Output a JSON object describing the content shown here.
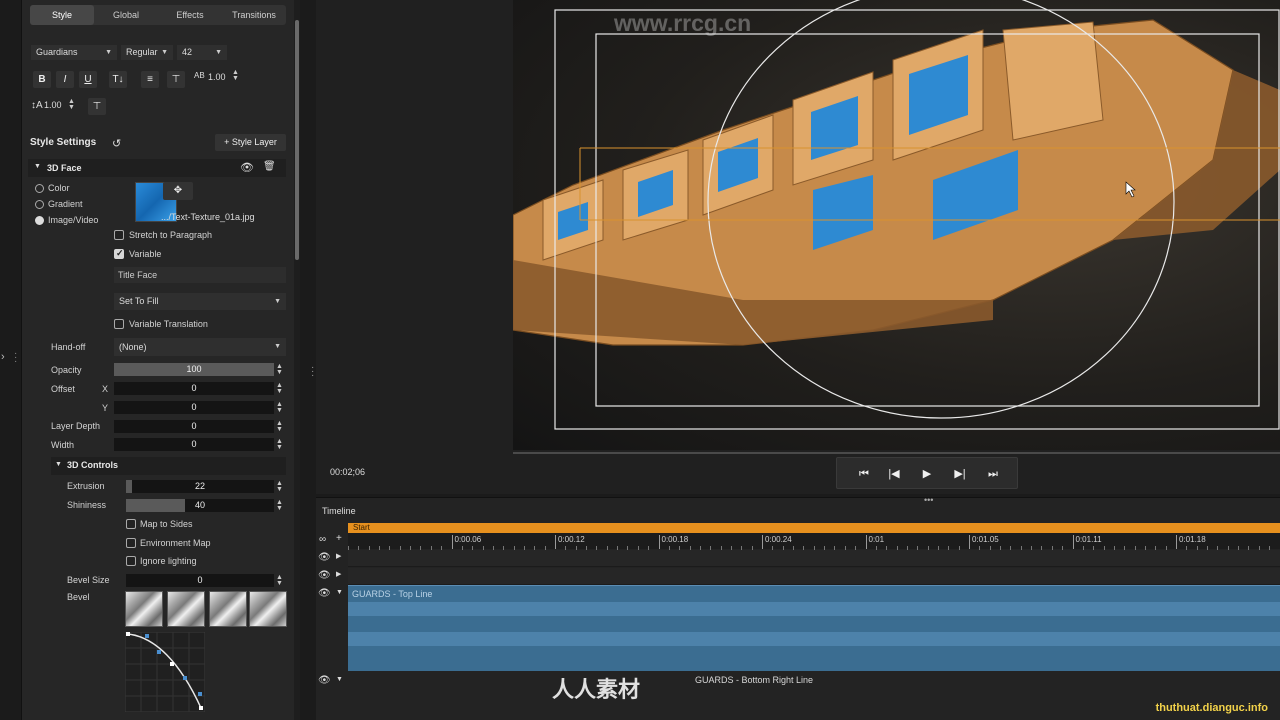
{
  "tabs": [
    "Style",
    "Global",
    "Effects",
    "Transitions"
  ],
  "font": {
    "family": "Guardians",
    "weight": "Regular",
    "size": "42"
  },
  "format": {
    "bold": "B",
    "italic": "I",
    "underline": "U",
    "tracking_value": "1.00",
    "leading_value": "1.00"
  },
  "style_settings": {
    "title": "Style Settings",
    "add_layer": "+ Style Layer"
  },
  "face": {
    "title": "3D Face",
    "fill_options": [
      "Color",
      "Gradient",
      "Image/Video"
    ],
    "texture_file": ".../Text-Texture_01a.jpg",
    "stretch_label": "Stretch to Paragraph",
    "variable_label": "Variable",
    "variable_name": "Title Face",
    "fill_mode": "Set To Fill",
    "variable_translation": "Variable Translation"
  },
  "params": {
    "handoff_label": "Hand-off",
    "handoff_value": "(None)",
    "opacity_label": "Opacity",
    "opacity_value": "100",
    "offset_label": "Offset",
    "x_label": "X",
    "x_value": "0",
    "y_label": "Y",
    "y_value": "0",
    "layer_depth_label": "Layer Depth",
    "layer_depth_value": "0",
    "width_label": "Width",
    "width_value": "0"
  },
  "controls_3d": {
    "title": "3D Controls",
    "extrusion_label": "Extrusion",
    "extrusion_value": "22",
    "shininess_label": "Shininess",
    "shininess_value": "40",
    "map_sides": "Map to Sides",
    "env_map": "Environment Map",
    "ignore_lighting": "Ignore lighting",
    "bevel_size_label": "Bevel Size",
    "bevel_size_value": "0",
    "bevel_label": "Bevel"
  },
  "viewer": {
    "timecode": "00:02;06"
  },
  "timeline": {
    "title": "Timeline",
    "start_label": "Start",
    "ticks": [
      "0:00.06",
      "0:00.12",
      "0:00.18",
      "0:00.24",
      "0:01",
      "0:01.05",
      "0:01.11",
      "0:01.18"
    ],
    "clip1": "GUARDS - Top Line",
    "clip2": "GUARDS - Bottom Right Line"
  },
  "watermarks": {
    "top": "www.rrcg.cn",
    "bottom": "thuthuat.dianguc.info",
    "logo": "人人素材"
  },
  "colors": {
    "accent": "#e6901e",
    "clip": "#3b6d91",
    "panel": "#262626"
  }
}
